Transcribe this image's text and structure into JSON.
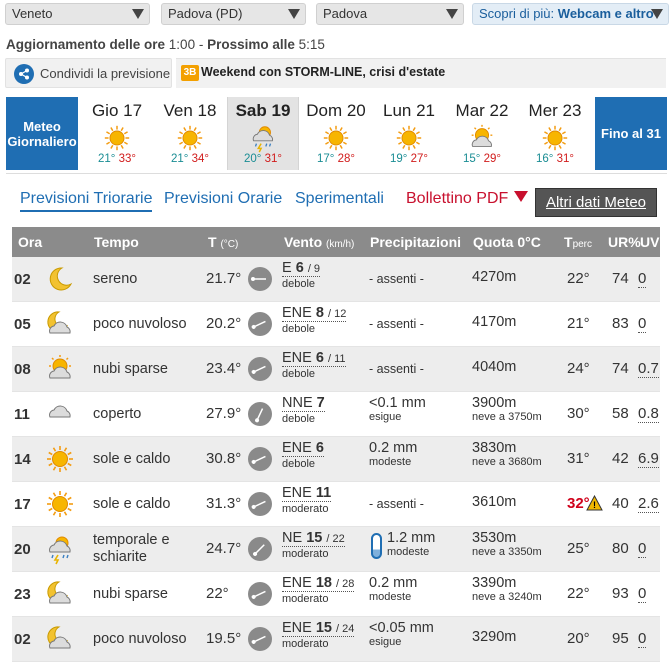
{
  "selects": {
    "region": "Veneto",
    "province": "Padova (PD)",
    "city": "Padova",
    "more_prefix": "Scopri di più:",
    "more_value": "Webcam e altro"
  },
  "update": {
    "label": "Aggiornamento delle ore",
    "time": "1:00",
    "next_label": "Prossimo alle",
    "next_time": "5:15"
  },
  "share": {
    "label": "Condividi la previsione"
  },
  "news": {
    "logo": "3B",
    "headline": "Weekend con STORM-LINE, crisi d'estate"
  },
  "days": {
    "left_button": "Meteo Giornaliero",
    "right_button": "Fino al 31",
    "items": [
      {
        "name": "Gio 17",
        "min": "21°",
        "max": "33°",
        "icon": "sun-icon"
      },
      {
        "name": "Ven 18",
        "min": "21°",
        "max": "34°",
        "icon": "sun-icon"
      },
      {
        "name": "Sab 19",
        "min": "20°",
        "max": "31°",
        "icon": "storm-icon"
      },
      {
        "name": "Dom 20",
        "min": "17°",
        "max": "28°",
        "icon": "sun-icon"
      },
      {
        "name": "Lun 21",
        "min": "19°",
        "max": "27°",
        "icon": "sun-icon"
      },
      {
        "name": "Mar 22",
        "min": "15°",
        "max": "29°",
        "icon": "sun-cloud-icon"
      },
      {
        "name": "Mer 23",
        "min": "16°",
        "max": "31°",
        "icon": "sun-icon"
      }
    ]
  },
  "tabs": {
    "triorarie": "Previsioni Triorarie",
    "orarie": "Previsioni Orarie",
    "sperimentali": "Sperimentali",
    "pdf": "Bollettino PDF",
    "altri": "Altri dati Meteo"
  },
  "table": {
    "headers": {
      "ora": "Ora",
      "tempo": "Tempo",
      "t": "T",
      "t_unit": "(°C)",
      "vento": "Vento",
      "vento_unit": "(km/h)",
      "precip": "Precipitazioni",
      "quota": "Quota 0°C",
      "tperc": "T",
      "tperc_sub": "perc",
      "ur": "UR%",
      "uv": "UV"
    },
    "rows": [
      {
        "ora": "02",
        "icon": "moon-icon",
        "tempo": "sereno",
        "t": "21.7°",
        "wind_dir": "E",
        "wind_speed": "6",
        "gust": "/ 9",
        "wind_desc": "debole",
        "precip": "- assenti -",
        "precip_sub": "",
        "quota": "4270m",
        "quota_sub": "",
        "tperc": "22°",
        "ur": "74",
        "uv": "0"
      },
      {
        "ora": "05",
        "icon": "moon-cloud-icon",
        "tempo": "poco nuvoloso",
        "t": "20.2°",
        "wind_dir": "ENE",
        "wind_speed": "8",
        "gust": "/ 12",
        "wind_desc": "debole",
        "precip": "- assenti -",
        "precip_sub": "",
        "quota": "4170m",
        "quota_sub": "",
        "tperc": "21°",
        "ur": "83",
        "uv": "0"
      },
      {
        "ora": "08",
        "icon": "sun-cloud-icon",
        "tempo": "nubi sparse",
        "t": "23.4°",
        "wind_dir": "ENE",
        "wind_speed": "6",
        "gust": "/ 11",
        "wind_desc": "debole",
        "precip": "- assenti -",
        "precip_sub": "",
        "quota": "4040m",
        "quota_sub": "",
        "tperc": "24°",
        "ur": "74",
        "uv": "0.7"
      },
      {
        "ora": "11",
        "icon": "cloud-icon",
        "tempo": "coperto",
        "t": "27.9°",
        "wind_dir": "NNE",
        "wind_speed": "7",
        "gust": "",
        "wind_desc": "debole",
        "precip": "<0.1 mm",
        "precip_sub": "esigue",
        "quota": "3900m",
        "quota_sub": "neve a 3750m",
        "tperc": "30°",
        "ur": "58",
        "uv": "0.8"
      },
      {
        "ora": "14",
        "icon": "sun-icon",
        "tempo": "sole e caldo",
        "t": "30.8°",
        "wind_dir": "ENE",
        "wind_speed": "6",
        "gust": "",
        "wind_desc": "debole",
        "precip": "0.2 mm",
        "precip_sub": "modeste",
        "quota": "3830m",
        "quota_sub": "neve a 3680m",
        "tperc": "31°",
        "ur": "42",
        "uv": "6.9"
      },
      {
        "ora": "17",
        "icon": "sun-icon",
        "tempo": "sole e caldo",
        "t": "31.3°",
        "wind_dir": "ENE",
        "wind_speed": "11",
        "gust": "",
        "wind_desc": "moderato",
        "precip": "- assenti -",
        "precip_sub": "",
        "quota": "3610m",
        "quota_sub": "",
        "tperc": "32°",
        "ur": "40",
        "uv": "2.6"
      },
      {
        "ora": "20",
        "icon": "storm-icon",
        "tempo": "temporale e schiarite",
        "t": "24.7°",
        "wind_dir": "NE",
        "wind_speed": "15",
        "gust": "/ 22",
        "wind_desc": "moderato",
        "precip": "1.2 mm",
        "precip_sub": "modeste",
        "quota": "3530m",
        "quota_sub": "neve a 3350m",
        "tperc": "25°",
        "ur": "80",
        "uv": "0"
      },
      {
        "ora": "23",
        "icon": "moon-cloud-icon",
        "tempo": "nubi sparse",
        "t": "22°",
        "wind_dir": "ENE",
        "wind_speed": "18",
        "gust": "/ 28",
        "wind_desc": "moderato",
        "precip": "0.2 mm",
        "precip_sub": "modeste",
        "quota": "3390m",
        "quota_sub": "neve a 3240m",
        "tperc": "22°",
        "ur": "93",
        "uv": "0"
      },
      {
        "ora": "02",
        "icon": "moon-cloud-icon",
        "tempo": "poco nuvoloso",
        "t": "19.5°",
        "wind_dir": "ENE",
        "wind_speed": "15",
        "gust": "/ 24",
        "wind_desc": "moderato",
        "precip": "<0.05 mm",
        "precip_sub": "esigue",
        "quota": "3290m",
        "quota_sub": "",
        "tperc": "20°",
        "ur": "95",
        "uv": "0"
      }
    ]
  },
  "colors": {
    "accent": "#1f6eb3",
    "header_gray": "#8b8b8b",
    "hot": "#d0021b",
    "min_temp": "#1a8d94",
    "max_temp": "#d11c1c"
  }
}
